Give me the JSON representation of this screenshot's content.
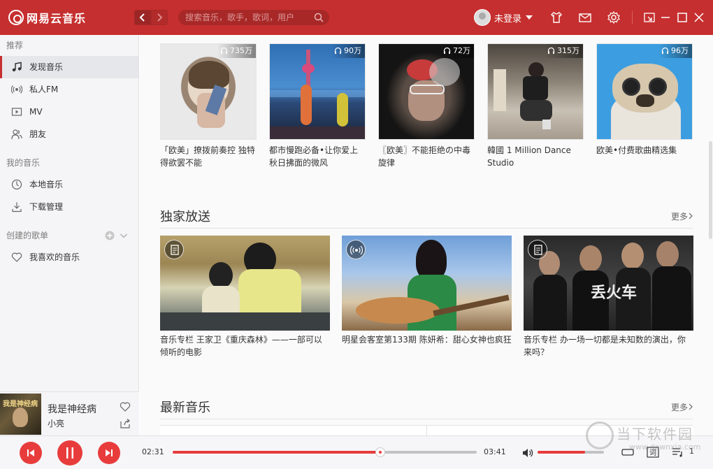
{
  "app": {
    "name": "网易云音乐"
  },
  "search": {
    "placeholder": "搜索音乐，歌手，歌词，用户"
  },
  "user": {
    "name": "未登录"
  },
  "colors": {
    "accent": "#c62f2f",
    "player_accent": "#e83c3c"
  },
  "sidebar": {
    "recommend_header": "推荐",
    "recommend_items": [
      {
        "label": "发现音乐",
        "icon": "music-note-icon",
        "active": true
      },
      {
        "label": "私人FM",
        "icon": "radio-icon"
      },
      {
        "label": "MV",
        "icon": "video-icon"
      },
      {
        "label": "朋友",
        "icon": "friends-icon"
      }
    ],
    "my_music_header": "我的音乐",
    "my_music_items": [
      {
        "label": "本地音乐",
        "icon": "local-music-icon"
      },
      {
        "label": "下载管理",
        "icon": "download-icon"
      }
    ],
    "created_header": "创建的歌单",
    "created_items": [
      {
        "label": "我喜欢的音乐",
        "icon": "heart-icon"
      }
    ]
  },
  "now_playing": {
    "song": "我是神经病",
    "artist": "小亮",
    "cover_text": "我是神经病"
  },
  "playlists": [
    {
      "count": "735万",
      "title": "「欧美」撩拨前奏控 独特得欲罢不能"
    },
    {
      "count": "90万",
      "title": "都市慢跑必备•让你爱上秋日拂面的微风"
    },
    {
      "count": "72万",
      "title": "〖欧美〗不能拒绝の中毒旋律"
    },
    {
      "count": "315万",
      "title": "韓國 1 Million Dance Studio"
    },
    {
      "count": "96万",
      "title": "欧美•付费歌曲精选集"
    }
  ],
  "exclusive": {
    "title": "独家放送",
    "more": "更多",
    "items": [
      {
        "title": "音乐专栏 王家卫《重庆森林》——一部可以倾听的电影",
        "badge": "article-icon"
      },
      {
        "title": "明星会客室第133期 陈妍希：甜心女神也疯狂",
        "badge": "radio-icon"
      },
      {
        "title": "音乐专栏 办一场一切都是未知数的演出，你来吗？",
        "badge": "article-icon"
      }
    ]
  },
  "newest": {
    "title": "最新音乐",
    "more": "更多"
  },
  "player": {
    "current_time": "02:31",
    "total_time": "03:41",
    "progress": 0.683,
    "volume": 0.72,
    "playlist_count": "1"
  },
  "watermark": {
    "text": "当下软件园",
    "url": "www.downxia.com"
  }
}
